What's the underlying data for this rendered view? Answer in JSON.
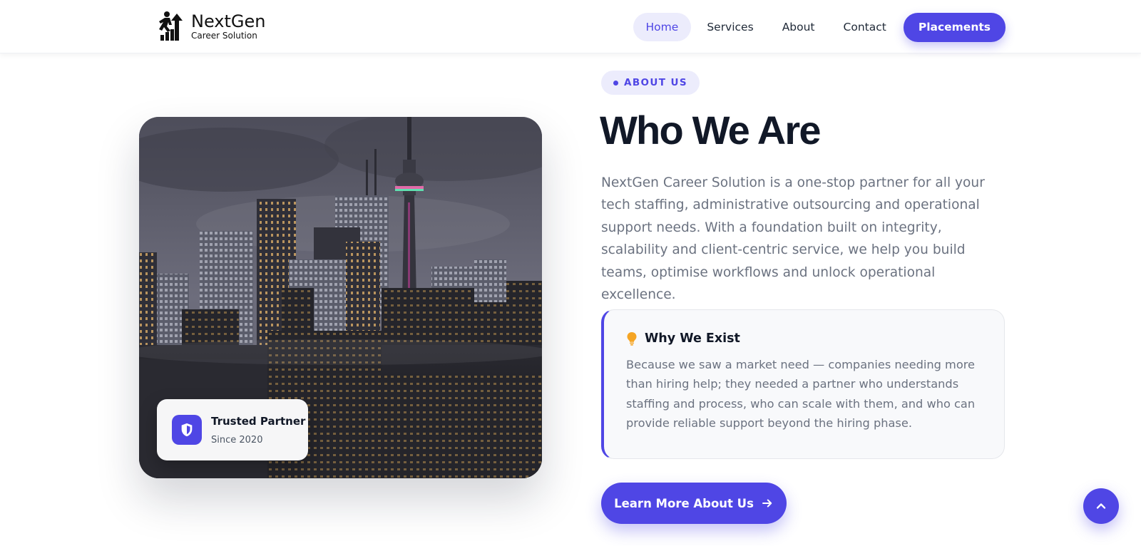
{
  "header": {
    "logo": {
      "name": "NextGen",
      "tagline": "Career Solution"
    },
    "nav": [
      {
        "label": "Home",
        "active": true
      },
      {
        "label": "Services",
        "active": false
      },
      {
        "label": "About",
        "active": false
      },
      {
        "label": "Contact",
        "active": false
      }
    ],
    "cta_label": "Placements"
  },
  "media": {
    "image": "city-skyline-photo",
    "badge": {
      "icon": "shield-icon",
      "title": "Trusted Partner",
      "subtitle": "Since 2020"
    }
  },
  "about": {
    "eyebrow": "ABOUT US",
    "title": "Who We Are",
    "description": "NextGen Career Solution is a one-stop partner for all your tech staffing, administrative outsourcing and operational support needs. With a foundation built on integrity, scalability and client-centric service, we help you build teams, optimise workflows and unlock operational excellence.",
    "why": {
      "icon": "lightbulb-icon",
      "title": "Why We Exist",
      "body": "Because we saw a market need — companies needing more than hiring help; they needed a partner who understands staffing and process, who can scale with them, and who can provide reliable support beyond the hiring phase."
    },
    "cta_label": "Learn More About Us",
    "cta_icon": "arrow-right-icon"
  },
  "scroll_top_icon": "chevron-up-icon",
  "colors": {
    "accent": "#4f46e5",
    "accent_soft": "#ececfc",
    "text": "#111827",
    "muted": "#6b7280"
  }
}
